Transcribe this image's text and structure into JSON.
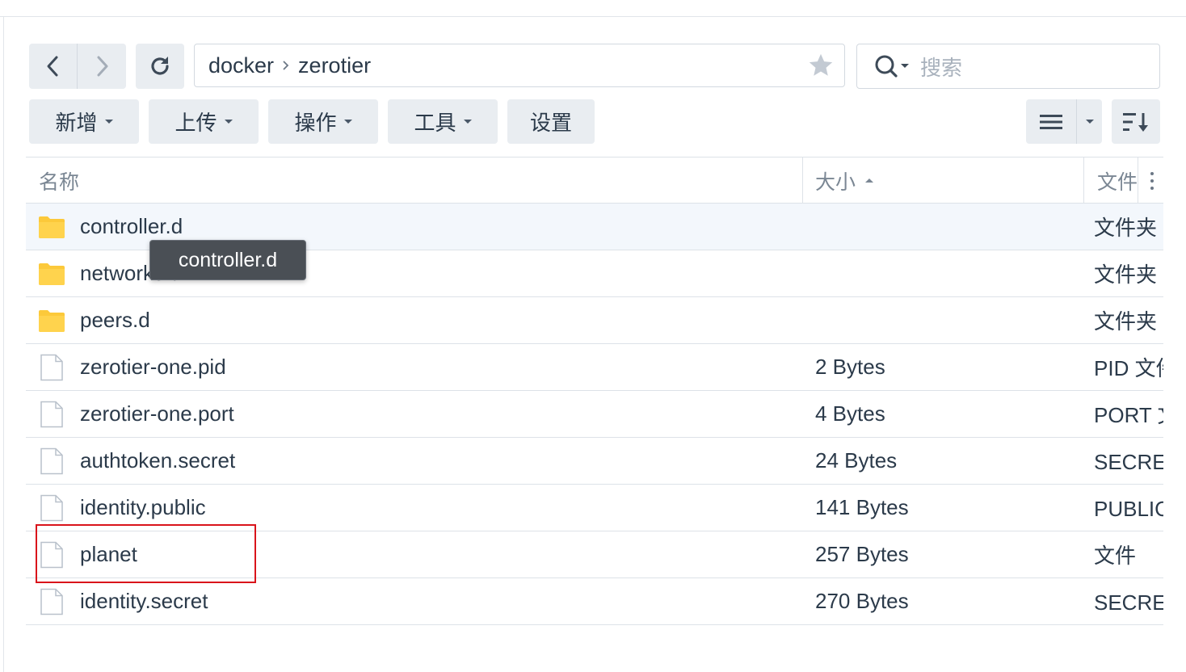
{
  "nav": {
    "back_icon": "chevron-left-icon",
    "forward_icon": "chevron-right-icon",
    "refresh_icon": "refresh-icon"
  },
  "path": {
    "segments": [
      "docker",
      "zerotier"
    ],
    "favorite_icon": "star-icon"
  },
  "search": {
    "placeholder": "搜索",
    "icon": "search-icon"
  },
  "toolbar": {
    "new_label": "新增",
    "upload_label": "上传",
    "action_label": "操作",
    "tools_label": "工具",
    "settings_label": "设置"
  },
  "view": {
    "list_icon": "list-view-icon",
    "sort_icon": "sort-icon"
  },
  "table": {
    "columns": {
      "name": "名称",
      "size": "大小",
      "type": "文件"
    },
    "rows": [
      {
        "name": "controller.d",
        "size": "",
        "type": "文件夹",
        "icon": "folder-icon"
      },
      {
        "name": "networks.d",
        "size": "",
        "type": "文件夹",
        "icon": "folder-icon"
      },
      {
        "name": "peers.d",
        "size": "",
        "type": "文件夹",
        "icon": "folder-icon"
      },
      {
        "name": "zerotier-one.pid",
        "size": "2 Bytes",
        "type": "PID 文件",
        "icon": "file-icon"
      },
      {
        "name": "zerotier-one.port",
        "size": "4 Bytes",
        "type": "PORT 文件",
        "icon": "file-icon"
      },
      {
        "name": "authtoken.secret",
        "size": "24 Bytes",
        "type": "SECRET 文件",
        "icon": "file-icon"
      },
      {
        "name": "identity.public",
        "size": "141 Bytes",
        "type": "PUBLIC 文件",
        "icon": "file-icon"
      },
      {
        "name": "planet",
        "size": "257 Bytes",
        "type": "文件",
        "icon": "file-icon"
      },
      {
        "name": "identity.secret",
        "size": "270 Bytes",
        "type": "SECRET 文件",
        "icon": "file-icon"
      }
    ]
  },
  "tooltip": {
    "text": "controller.d"
  },
  "colors": {
    "button_bg": "#e9edf1",
    "folder": "#fcc93a",
    "highlight": "#d9141b",
    "tooltip_bg": "#4a4f55"
  }
}
